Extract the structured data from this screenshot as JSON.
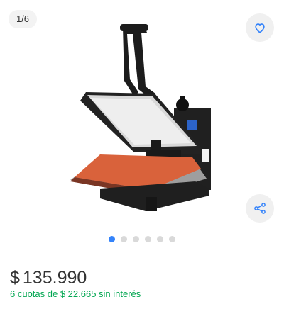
{
  "gallery": {
    "counter": "1/6",
    "favorite_icon": "heart-icon",
    "share_icon": "share-icon",
    "image_subject": "heat-press-machine",
    "dots_total": 6,
    "dots_active": 1,
    "accent_color": "#3483fa"
  },
  "price": {
    "currency": "$",
    "amount": "135.990",
    "installments": "6 cuotas de $ 22.665 sin interés",
    "installments_color": "#00a650"
  }
}
